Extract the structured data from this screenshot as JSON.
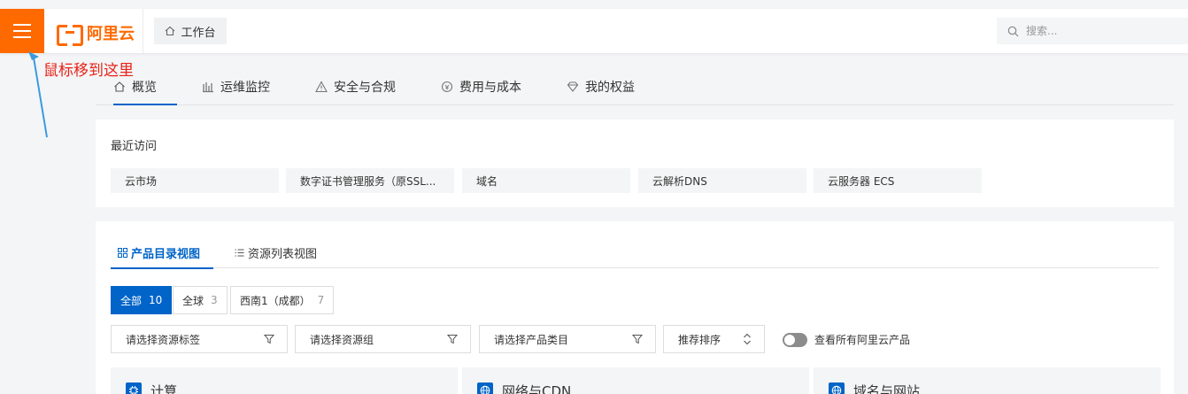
{
  "topbar": {
    "logo_text": "阿里云",
    "workbench_label": "工作台",
    "search_placeholder": "搜索...",
    "brand_color": "#ff6a00"
  },
  "annotation": {
    "text": "鼠标移到这里",
    "color": "#e8231a"
  },
  "tabs": [
    {
      "label": "概览",
      "icon": "home-icon",
      "active": true
    },
    {
      "label": "运维监控",
      "icon": "bar-chart-icon"
    },
    {
      "label": "安全与合规",
      "icon": "warning-icon"
    },
    {
      "label": "费用与成本",
      "icon": "cost-icon"
    },
    {
      "label": "我的权益",
      "icon": "diamond-icon"
    }
  ],
  "recent": {
    "title": "最近访问",
    "items": [
      "云市场",
      "数字证书管理服务（原SSL...",
      "域名",
      "云解析DNS",
      "云服务器 ECS"
    ]
  },
  "products": {
    "view_tabs": [
      {
        "label": "产品目录视图",
        "icon": "grid-icon",
        "active": true
      },
      {
        "label": "资源列表视图",
        "icon": "list-icon"
      }
    ],
    "regions": [
      {
        "label": "全部",
        "count": "10",
        "active": true
      },
      {
        "label": "全球",
        "count": "3"
      },
      {
        "label": "西南1（成都）",
        "count": "7"
      }
    ],
    "filters": {
      "tag": "请选择资源标签",
      "group": "请选择资源组",
      "category": "请选择产品类目",
      "sort": "推荐排序"
    },
    "toggle_label": "查看所有阿里云产品",
    "categories": [
      {
        "label": "计算",
        "icon": "cpu-icon"
      },
      {
        "label": "网络与CDN",
        "icon": "globe-icon"
      },
      {
        "label": "域名与网站",
        "icon": "globe-icon"
      }
    ],
    "accent_color": "#0064c8"
  }
}
